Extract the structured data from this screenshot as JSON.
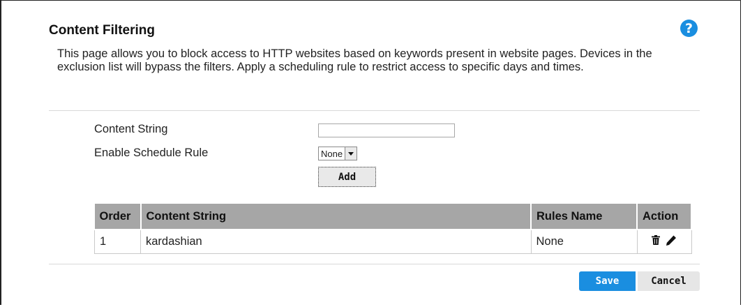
{
  "page": {
    "title": "Content Filtering",
    "help_label": "?",
    "description": "This page allows you to block access to HTTP websites based on keywords present in website pages. Devices in the exclusion list will bypass the filters. Apply a scheduling rule to restrict access to specific days and times."
  },
  "form": {
    "content_string_label": "Content String",
    "content_string_value": "",
    "schedule_label": "Enable Schedule Rule",
    "schedule_selected": "None",
    "add_label": "Add"
  },
  "table": {
    "headers": [
      "Order",
      "Content String",
      "Rules Name",
      "Action"
    ],
    "rows": [
      {
        "order": "1",
        "content": "kardashian",
        "rule": "None",
        "actions": [
          "trash-icon",
          "edit-pencil-icon"
        ]
      }
    ]
  },
  "footer": {
    "save_label": "Save",
    "cancel_label": "Cancel"
  },
  "colors": {
    "accent": "#1a8ee0",
    "table_header": "#a6a6a6"
  }
}
